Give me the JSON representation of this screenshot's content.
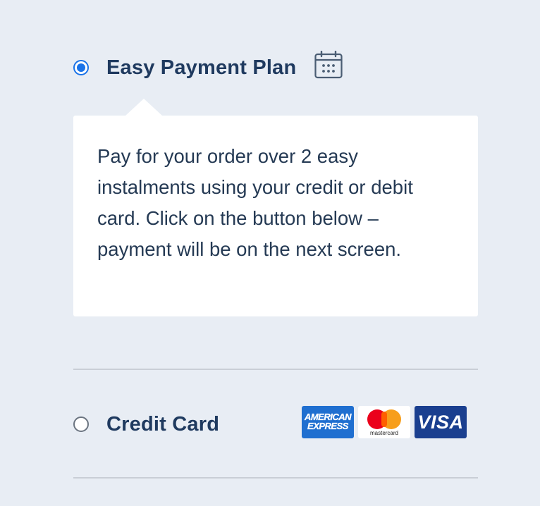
{
  "payment_options": {
    "easy_plan": {
      "label": "Easy Payment Plan",
      "selected": true,
      "icon": "calendar-icon",
      "description": "Pay for your order over 2 easy instalments using your credit or debit card. Click on the button below – payment will be on the next screen."
    },
    "credit_card": {
      "label": "Credit Card",
      "selected": false,
      "card_logos": {
        "amex": {
          "line1": "AMERICAN",
          "line2": "EXPRESS"
        },
        "mastercard": {
          "text": "mastercard"
        },
        "visa": {
          "text": "VISA"
        }
      }
    }
  },
  "colors": {
    "background": "#e8edf4",
    "accent": "#1a73e8",
    "text": "#1f3a5f",
    "panel": "#ffffff",
    "divider": "#c9ced6"
  }
}
